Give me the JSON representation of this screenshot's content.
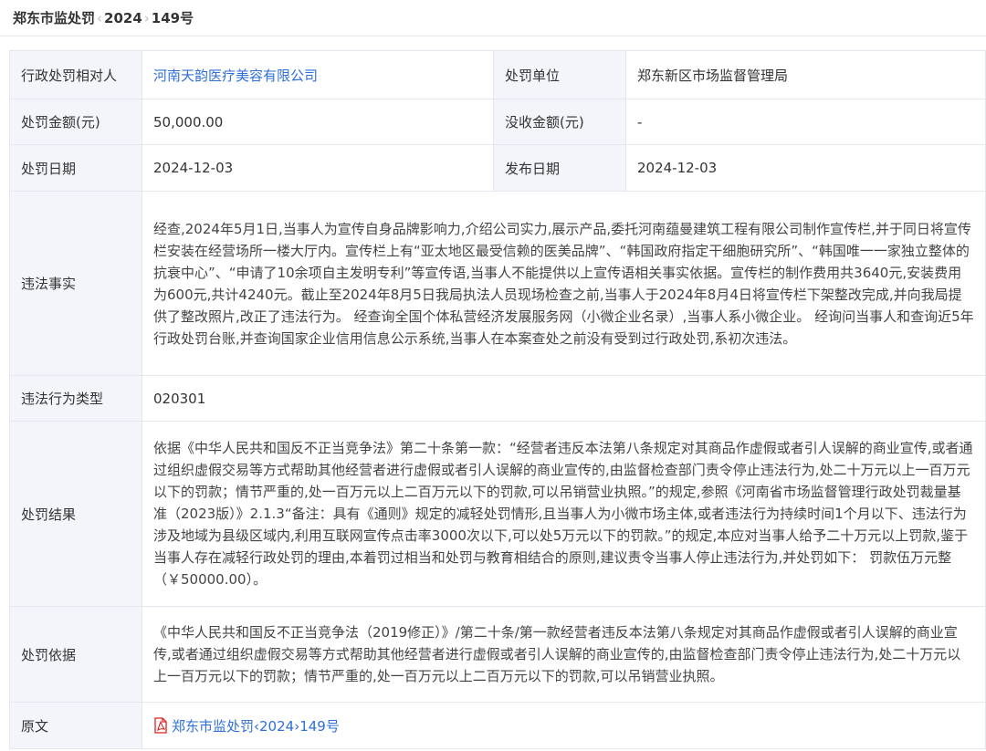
{
  "header": {
    "title_prefix": "郑东市监处罚",
    "year": "2024",
    "title_suffix": "149号"
  },
  "rows": {
    "party": {
      "label": "行政处罚相对人",
      "value": "河南天韵医疗美容有限公司"
    },
    "agency": {
      "label": "处罚单位",
      "value": "郑东新区市场监督管理局"
    },
    "fine": {
      "label": "处罚金额(元)",
      "value": "50,000.00"
    },
    "confiscation": {
      "label": "没收金额(元)",
      "value": "-"
    },
    "penalty_date": {
      "label": "处罚日期",
      "value": "2024-12-03"
    },
    "publish_date": {
      "label": "发布日期",
      "value": "2024-12-03"
    },
    "facts": {
      "label": "违法事实",
      "value": "经查,2024年5月1日,当事人为宣传自身品牌影响力,介绍公司实力,展示产品,委托河南蕴曼建筑工程有限公司制作宣传栏,并于同日将宣传栏安装在经营场所一楼大厅内。宣传栏上有“亚太地区最受信赖的医美品牌”、“韩国政府指定干细胞研究所”、“韩国唯一一家独立整体的抗衰中心”、“申请了10余项自主发明专利”等宣传语,当事人不能提供以上宣传语相关事实依据。宣传栏的制作费用共3640元,安装费用为600元,共计4240元。截止至2024年8月5日我局执法人员现场检查之前,当事人于2024年8月4日将宣传栏下架整改完成,并向我局提供了整改照片,改正了违法行为。 经查询全国个体私营经济发展服务网（小微企业名录）,当事人系小微企业。 经询问当事人和查询近5年行政处罚台账,并查询国家企业信用信息公示系统,当事人在本案查处之前没有受到过行政处罚,系初次违法。"
    },
    "violation_type": {
      "label": "违法行为类型",
      "value": "020301"
    },
    "result": {
      "label": "处罚结果",
      "value": "依据《中华人民共和国反不正当竞争法》第二十条第一款：“经营者违反本法第八条规定对其商品作虚假或者引人误解的商业宣传,或者通过组织虚假交易等方式帮助其他经营者进行虚假或者引人误解的商业宣传的,由监督检查部门责令停止违法行为,处二十万元以上一百万元以下的罚款；情节严重的,处一百万元以上二百万元以下的罚款,可以吊销营业执照。”的规定,参照《河南省市场监督管理行政处罚裁量基准（2023版）》2.1.3“备注：具有《通则》规定的减轻处罚情形,且当事人为小微市场主体,或者违法行为持续时间1个月以下、违法行为涉及地域为县级区域内,利用互联网宣传点击率3000次以下,可以处5万元以下的罚款。”的规定,本应对当事人给予二十万元以上罚款,鉴于当事人存在减轻行政处罚的理由,本着罚过相当和处罚与教育相结合的原则,建议责令当事人停止违法行为,并处罚如下： 罚款伍万元整（￥50000.00）。"
    },
    "basis": {
      "label": "处罚依据",
      "value": "《中华人民共和国反不正当竞争法（2019修正）》/第二十条/第一款经营者违反本法第八条规定对其商品作虚假或者引人误解的商业宣传,或者通过组织虚假交易等方式帮助其他经营者进行虚假或者引人误解的商业宣传的,由监督检查部门责令停止违法行为,处二十万元以上一百万元以下的罚款；情节严重的,处一百万元以上二百万元以下的罚款,可以吊销营业执照。"
    },
    "original": {
      "label": "原文",
      "link_prefix": "郑东市监处罚",
      "link_year": "2024",
      "link_suffix": "149号"
    }
  },
  "colors": {
    "label_bg": "#f3f5fa",
    "border": "#e4e7ed",
    "link": "#2e6fd8",
    "pdf_red": "#e02020"
  },
  "icons": {
    "pdf": "pdf-file-icon"
  }
}
